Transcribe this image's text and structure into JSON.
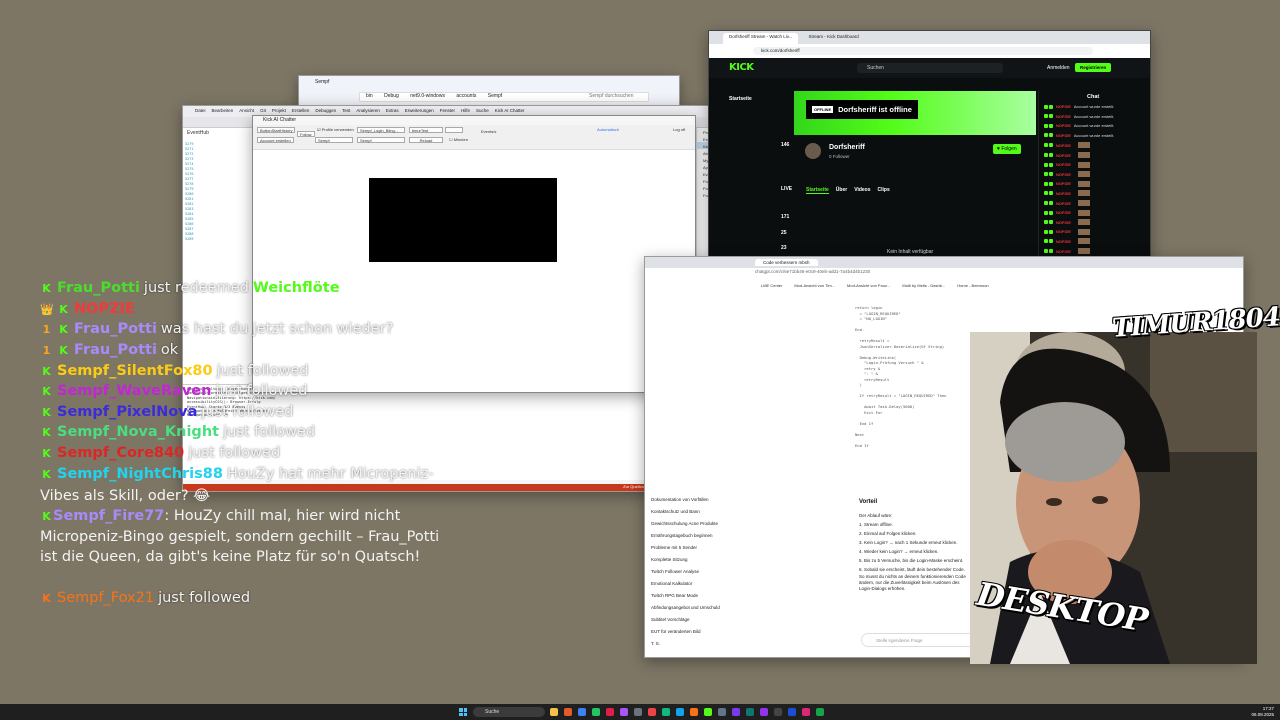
{
  "explorer": {
    "title": "Sempf",
    "path": [
      "bin",
      "Debug",
      "net9.0-windows",
      "accounts",
      "Sempf"
    ],
    "search_placeholder": "Sempf durchsuchen"
  },
  "vs": {
    "menu": [
      "Datei",
      "Bearbeiten",
      "Ansicht",
      "Git",
      "Projekt",
      "Erstellen",
      "Debuggen",
      "Test",
      "Analysieren",
      "Extras",
      "Erweiterungen",
      "Fenster",
      "Hilfe",
      "Suche"
    ],
    "project": "Kick AI Chatter",
    "editor_tab": "EventHub",
    "line_numbers": [
      "5279",
      "5271",
      "5272",
      "5273",
      "5274",
      "5275",
      "5276",
      "5277",
      "5278",
      "5279",
      "5280",
      "5281",
      "5282",
      "5283",
      "5284",
      "5285",
      "5286",
      "5287",
      "5288",
      "5289"
    ],
    "solution_items": [
      "Projektmappe 'Kick AI Chatter'",
      "Externe Quellen",
      "Kick AI Chatter",
      "Abhängigkeiten",
      "My Project",
      "ApplicationEvents.vb",
      "EventHub",
      "Form1",
      "Form1.Designer.vb",
      "Form1.resx"
    ],
    "output_lines": [
      "Kontenverwaltung; Server konfigurieren",
      "SendRaumInformation: Fehlgeschlagen",
      "Navigationsinitiierung: https://kick.com/",
      "accessibilityCSS(): Browser-Erfolg",
      "EventHub: Starte 3/3 Events",
      "Navigation: erfolgreich abgeschlossen",
      "Navigationsende: OK"
    ],
    "status": "Zur Quellcodeverwaltung hinzufügen",
    "status_repo": "Repository auswählen"
  },
  "kickform": {
    "title": "Kick AI Chatter",
    "button_start": "ButtonStartHistory",
    "button_follow": "Follow",
    "button_account": "Account erstellen",
    "checkbox_label": "Profile verwenden",
    "select_profile": "Sempf_Login_Bling...",
    "select_user": "Sempf",
    "input_model": "timurTest",
    "reload_label": "Reload",
    "events_label": "Events/s",
    "minutes_label": "Minuten",
    "right_link": "Automatisch",
    "log_label": "Log off"
  },
  "browser": {
    "tabs": [
      "Dorfsheriff Stream - Watch Liv...",
      "Stream - Kick Dashboard"
    ],
    "url": "kick.com/dorfsheriff",
    "logo": "KICK",
    "search_placeholder": "Suchen",
    "login": "Anmelden",
    "register": "Registrieren",
    "home": "Startseite",
    "side_numbers": [
      "146",
      "LIVE",
      "171",
      "25",
      "23",
      "20",
      "20"
    ],
    "offline_badge": "OFFLINE",
    "offline_text": "Dorfsheriff ist offline",
    "channel_name": "Dorfsheriff",
    "followers": "0 Follower",
    "follow_button": "Folgen",
    "channel_tabs": [
      "Startseite",
      "Über",
      "Videos",
      "Clips"
    ],
    "empty_text": "Kein Inhalt verfügbar",
    "chat_title": "Chat",
    "chat_rows": [
      {
        "user": "NOPZIE",
        "msg": "Account wurde erstellt."
      },
      {
        "user": "NOPZIE",
        "msg": "Account wurde erstellt."
      },
      {
        "user": "NOPZIE",
        "msg": "Account wurde erstellt."
      },
      {
        "user": "NOPZIE",
        "msg": "Account wurde erstellt."
      },
      {
        "user": "NOPZIE",
        "msg": ""
      },
      {
        "user": "NOPZIE",
        "msg": ""
      },
      {
        "user": "NOPZIE",
        "msg": ""
      },
      {
        "user": "NOPZIE",
        "msg": ""
      },
      {
        "user": "NOPZIE",
        "msg": ""
      },
      {
        "user": "NOPZIE",
        "msg": ""
      },
      {
        "user": "NOPZIE",
        "msg": ""
      },
      {
        "user": "NOPZIE",
        "msg": ""
      },
      {
        "user": "NOPZIE",
        "msg": ""
      },
      {
        "user": "NOPZIE",
        "msg": ""
      },
      {
        "user": "NOPZIE",
        "msg": ""
      },
      {
        "user": "NOPZIE",
        "msg": ""
      }
    ]
  },
  "gpt": {
    "tab": "Code verbessern mbsh",
    "url": "chatgpt.com/c/6e71bb46-e0c9-40eb-add1-7a4b4d4b1230",
    "bookmarks": [
      "LME Center",
      "Mod-Ansicht von Tim...",
      "Mod-Ansicht von Pouz...",
      "Multi by Metis - Dashb...",
      "Home - Beemoon"
    ],
    "sidebar": [
      "Dokumentation von Vorfällen",
      "Kontaktschutz und Bann",
      "Gewichtsschulung Acne Produkte",
      "Ernährungstagebuch beginnen",
      "Probleme mit 5 Sender",
      "Komplette Sitzung",
      "Twitch Follower Analyse",
      "Emotional Kalkulator",
      "Twitch RPG Bear Mode",
      "Abfindungsangebot und Umschuld",
      "Subtitel Vorschläge",
      "EUT für veränderten Bild",
      "T. S."
    ],
    "code_lines": [
      "return login",
      "  = \"LOGIN_REQUIRED\"",
      "  = \"NO_LOGIN\"",
      "",
      "End.",
      "",
      "  retryResult =",
      "  JsonSerializer.Deserialize(Of String)",
      "",
      "  Debug.WriteLine(",
      "    \"Login-Prüfung Versuch \" &",
      "    retry &",
      "    \": \" &",
      "    retryResult",
      "  )",
      "",
      "  If retryResult = \"LOGIN_REQUIRED\" Then",
      "",
      "    Await Task.Delay(5000)",
      "    Exit For",
      "",
      "  End If",
      "",
      "Next",
      "",
      "End If"
    ],
    "vorteil": "Vorteil",
    "steps_intro": "Der Ablauf wäre:",
    "steps": [
      "1. Stream offline.",
      "2. Einmal auf Folgen klicken.",
      "3. Kein Login? → nach 1 Sekunde erneut klicken.",
      "4. Wieder kein Login? → erneut klicken.",
      "5. Bis zu 5 Versuche, bis die Login-Maske erscheint.",
      "6. Sobald sie erscheint, läuft dein bestehender Code."
    ],
    "summary": "So musst du nichts an deinem funktionierenden Code ändern, nur die Zuverlässigkeit beim Auslösen des Login-Dialogs erhöhen.",
    "ask_placeholder": "Stelle irgendeine Frage"
  },
  "webcam": {
    "brand_top": "TIMUR1804",
    "brand_bottom": "DESKTOP"
  },
  "overlay": {
    "lines": [
      {
        "name": "Frau_Potti",
        "color": "#4ade2b",
        "text": "just redeemed",
        "extra": "Weichflöte",
        "extra_color": "#53fc18",
        "badges": [
          "K"
        ]
      },
      {
        "name": "NOPZIE",
        "color": "#ef3b3b",
        "text": "",
        "badges": [
          "👑",
          "K"
        ]
      },
      {
        "name": "Frau_Potti",
        "color": "#a78bfa",
        "text": "was hast du jetzt schon wieder?",
        "badges": [
          "1",
          "K"
        ]
      },
      {
        "name": "Frau_Potti",
        "color": "#a78bfa",
        "text": "ok",
        "badges": [
          "1",
          "K"
        ]
      },
      {
        "name": "Sempf_SilentFox80",
        "color": "#facc15",
        "text": "just followed",
        "badges": [
          "K"
        ]
      },
      {
        "name": "Sempf_WaveRaven",
        "color": "#c026d3",
        "text": "just followed",
        "badges": [
          "K"
        ]
      },
      {
        "name": "Sempf_PixelNova",
        "color": "#3b2bdb",
        "text": "just followed",
        "badges": [
          "K"
        ]
      },
      {
        "name": "Sempf_Nova_Knight",
        "color": "#4ade80",
        "text": "just followed",
        "badges": [
          "K"
        ]
      },
      {
        "name": "Sempf_Core840",
        "color": "#dc2626",
        "text": "just followed",
        "badges": [
          "K"
        ]
      },
      {
        "name": "Sempf_NightChris88",
        "color": "#22d3ee",
        "text": "HouZy hat mehr Micropeniz-",
        "badges": [
          "K"
        ]
      }
    ],
    "wrap1": "Vibes als Skill, oder? 😂",
    "fire_name": "Sempf_Fire77",
    "fire_text": ": HouZy chill mal, hier wird nicht Micropeniz-Bingo gespielt, sondern gechillt – Frau_Potti ist die Queen, da gibt's keine Platz für so'n Quatsch!",
    "fox_name": "Sempf_Fox21",
    "fox_text": "just followed"
  },
  "taskbar": {
    "search_placeholder": "Suche",
    "time": "17:27",
    "date": "06.08.2025"
  }
}
